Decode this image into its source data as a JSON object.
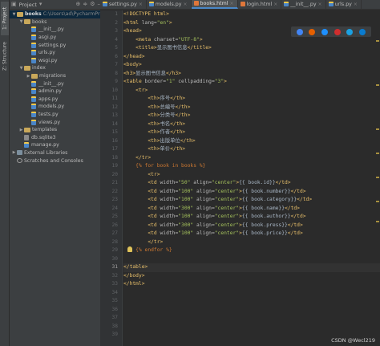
{
  "sidebar_tabs": {
    "project": "1: Project",
    "structure": "Z: Structure"
  },
  "project_panel": {
    "title": "Project",
    "tree": [
      {
        "name": "books",
        "extra": "C:\\Users\\ad\\PycharmPro",
        "type": "folder",
        "depth": 0,
        "expanded": true,
        "selected": true,
        "bold": true
      },
      {
        "name": "books",
        "type": "folder",
        "depth": 1,
        "expanded": true
      },
      {
        "name": "__init__.py",
        "type": "py",
        "depth": 2
      },
      {
        "name": "asgi.py",
        "type": "py",
        "depth": 2
      },
      {
        "name": "settings.py",
        "type": "py",
        "depth": 2
      },
      {
        "name": "urls.py",
        "type": "py",
        "depth": 2
      },
      {
        "name": "wsgi.py",
        "type": "py",
        "depth": 2
      },
      {
        "name": "index",
        "type": "folder",
        "depth": 1,
        "expanded": true
      },
      {
        "name": "migrations",
        "type": "folder",
        "depth": 2,
        "expanded": false
      },
      {
        "name": "__init__.py",
        "type": "py",
        "depth": 2
      },
      {
        "name": "admin.py",
        "type": "py",
        "depth": 2
      },
      {
        "name": "apps.py",
        "type": "py",
        "depth": 2
      },
      {
        "name": "models.py",
        "type": "py",
        "depth": 2
      },
      {
        "name": "tests.py",
        "type": "py",
        "depth": 2
      },
      {
        "name": "views.py",
        "type": "py",
        "depth": 2
      },
      {
        "name": "templates",
        "type": "folder",
        "depth": 1,
        "expanded": false
      },
      {
        "name": "db.sqlite3",
        "type": "db",
        "depth": 1
      },
      {
        "name": "manage.py",
        "type": "py",
        "depth": 1
      },
      {
        "name": "External Libraries",
        "type": "lib",
        "depth": 0,
        "expanded": false
      },
      {
        "name": "Scratches and Consoles",
        "type": "scratch",
        "depth": 0
      }
    ]
  },
  "tabs": [
    {
      "label": "settings.py",
      "type": "py",
      "active": false
    },
    {
      "label": "models.py",
      "type": "py",
      "active": false
    },
    {
      "label": "books.html",
      "type": "html",
      "active": true
    },
    {
      "label": "login.html",
      "type": "html",
      "active": false
    },
    {
      "label": "__init__.py",
      "type": "py",
      "active": false
    },
    {
      "label": "urls.py",
      "type": "py",
      "active": false
    }
  ],
  "colors": {
    "tag": "#e8bf6a",
    "attr": "#bababa",
    "value": "#a5c25c",
    "text": "#a9b7c6",
    "template": "#cc7832",
    "accent": "#4a88c7"
  },
  "browser_icons": [
    "chrome-icon",
    "firefox-icon",
    "safari-icon",
    "opera-icon",
    "ie-icon",
    "edge-icon"
  ],
  "browser_icon_colors": [
    "#4285f4",
    "#e66000",
    "#1e90ff",
    "#d02e2e",
    "#1ba1e2",
    "#0a7cd0"
  ],
  "code_lines": [
    [
      [
        "tag",
        "<!DOCTYPE html>"
      ]
    ],
    [
      [
        "tag",
        "<html "
      ],
      [
        "attr",
        "lang="
      ],
      [
        "value",
        "\"en\""
      ],
      [
        "tag",
        ">"
      ]
    ],
    [
      [
        "tag",
        "<head>"
      ]
    ],
    [
      [
        "text",
        "    "
      ],
      [
        "tag",
        "<meta "
      ],
      [
        "attr",
        "charset="
      ],
      [
        "value",
        "\"UTF-8\""
      ],
      [
        "tag",
        ">"
      ]
    ],
    [
      [
        "text",
        "    "
      ],
      [
        "tag",
        "<title>"
      ],
      [
        "text",
        "显示图书信息"
      ],
      [
        "tag",
        "</title>"
      ]
    ],
    [
      [
        "tag",
        "</head>"
      ]
    ],
    [
      [
        "tag",
        "<body>"
      ]
    ],
    [
      [
        "tag",
        "<h3>"
      ],
      [
        "text",
        "显示图书信息"
      ],
      [
        "tag",
        "</h3>"
      ]
    ],
    [
      [
        "tag",
        "<table "
      ],
      [
        "attr",
        "border="
      ],
      [
        "value",
        "\"1\" "
      ],
      [
        "attr",
        "cellpadding="
      ],
      [
        "value",
        "\"3\""
      ],
      [
        "tag",
        ">"
      ]
    ],
    [
      [
        "text",
        "    "
      ],
      [
        "tag",
        "<tr>"
      ]
    ],
    [
      [
        "text",
        "        "
      ],
      [
        "tag",
        "<th>"
      ],
      [
        "text",
        "序号"
      ],
      [
        "tag",
        "</th>"
      ]
    ],
    [
      [
        "text",
        "        "
      ],
      [
        "tag",
        "<th>"
      ],
      [
        "text",
        "总编号"
      ],
      [
        "tag",
        "</th>"
      ]
    ],
    [
      [
        "text",
        "        "
      ],
      [
        "tag",
        "<th>"
      ],
      [
        "text",
        "分类号"
      ],
      [
        "tag",
        "</th>"
      ]
    ],
    [
      [
        "text",
        "        "
      ],
      [
        "tag",
        "<th>"
      ],
      [
        "text",
        "书名"
      ],
      [
        "tag",
        "</th>"
      ]
    ],
    [
      [
        "text",
        "        "
      ],
      [
        "tag",
        "<th>"
      ],
      [
        "text",
        "作者"
      ],
      [
        "tag",
        "</th>"
      ]
    ],
    [
      [
        "text",
        "        "
      ],
      [
        "tag",
        "<th>"
      ],
      [
        "text",
        "出版单位"
      ],
      [
        "tag",
        "</th>"
      ]
    ],
    [
      [
        "text",
        "        "
      ],
      [
        "tag",
        "<th>"
      ],
      [
        "text",
        "单价"
      ],
      [
        "tag",
        "</th>"
      ]
    ],
    [
      [
        "text",
        "    "
      ],
      [
        "tag",
        "</tr>"
      ]
    ],
    [
      [
        "text",
        "    "
      ],
      [
        "template",
        "{% for book in books %}"
      ]
    ],
    [
      [
        "text",
        "        "
      ],
      [
        "tag",
        "<tr>"
      ]
    ],
    [
      [
        "text",
        "        "
      ],
      [
        "tag",
        "<td "
      ],
      [
        "attr",
        "width="
      ],
      [
        "value",
        "\"50\" "
      ],
      [
        "attr",
        "align="
      ],
      [
        "value",
        "\"center\""
      ],
      [
        "tag",
        ">"
      ],
      [
        "text",
        "{{ book.id}}"
      ],
      [
        "tag",
        "</td>"
      ]
    ],
    [
      [
        "text",
        "        "
      ],
      [
        "tag",
        "<td "
      ],
      [
        "attr",
        "width="
      ],
      [
        "value",
        "\"100\" "
      ],
      [
        "attr",
        "align="
      ],
      [
        "value",
        "\"center\""
      ],
      [
        "tag",
        ">"
      ],
      [
        "text",
        "{{ book.number}}"
      ],
      [
        "tag",
        "</td>"
      ]
    ],
    [
      [
        "text",
        "        "
      ],
      [
        "tag",
        "<td "
      ],
      [
        "attr",
        "width="
      ],
      [
        "value",
        "\"100\" "
      ],
      [
        "attr",
        "align="
      ],
      [
        "value",
        "\"center\""
      ],
      [
        "tag",
        ">"
      ],
      [
        "text",
        "{{ book.category}}"
      ],
      [
        "tag",
        "</td>"
      ]
    ],
    [
      [
        "text",
        "        "
      ],
      [
        "tag",
        "<td "
      ],
      [
        "attr",
        "width="
      ],
      [
        "value",
        "\"300\" "
      ],
      [
        "attr",
        "align="
      ],
      [
        "value",
        "\"center\""
      ],
      [
        "tag",
        ">"
      ],
      [
        "text",
        "{{ book.name}}"
      ],
      [
        "tag",
        "</td>"
      ]
    ],
    [
      [
        "text",
        "        "
      ],
      [
        "tag",
        "<td "
      ],
      [
        "attr",
        "width="
      ],
      [
        "value",
        "\"100\" "
      ],
      [
        "attr",
        "align="
      ],
      [
        "value",
        "\"center\""
      ],
      [
        "tag",
        ">"
      ],
      [
        "text",
        "{{ book.author}}"
      ],
      [
        "tag",
        "</td>"
      ]
    ],
    [
      [
        "text",
        "        "
      ],
      [
        "tag",
        "<td "
      ],
      [
        "attr",
        "width="
      ],
      [
        "value",
        "\"300\" "
      ],
      [
        "attr",
        "align="
      ],
      [
        "value",
        "\"center\""
      ],
      [
        "tag",
        ">"
      ],
      [
        "text",
        "{{ book.press}}"
      ],
      [
        "tag",
        "</td>"
      ]
    ],
    [
      [
        "text",
        "        "
      ],
      [
        "tag",
        "<td "
      ],
      [
        "attr",
        "width="
      ],
      [
        "value",
        "\"100\" "
      ],
      [
        "attr",
        "align="
      ],
      [
        "value",
        "\"center\""
      ],
      [
        "tag",
        ">"
      ],
      [
        "text",
        "{{ book.price}}"
      ],
      [
        "tag",
        "</td>"
      ]
    ],
    [
      [
        "text",
        "        "
      ],
      [
        "tag",
        "</tr>"
      ]
    ],
    [
      [
        "text",
        "    "
      ],
      [
        "template",
        "{% endfor %}"
      ]
    ],
    [],
    [
      [
        "tag",
        "</table>"
      ]
    ],
    [
      [
        "tag",
        "</body>"
      ]
    ],
    [
      [
        "tag",
        "</html>"
      ]
    ],
    [],
    [],
    [],
    [],
    [],
    []
  ],
  "line_numbers": [
    "1",
    "2",
    "3",
    "4",
    "5",
    "6",
    "7",
    "8",
    "9",
    "10",
    "11",
    "12",
    "13",
    "14",
    "15",
    "16",
    "17",
    "18",
    "19",
    "20",
    "21",
    "22",
    "23",
    "24",
    "25",
    "26",
    "27",
    "28",
    "29",
    "30",
    "31",
    "32",
    "33",
    "34",
    "35",
    "36",
    "37",
    "38",
    "39"
  ],
  "current_line": 31,
  "watermark": "CSDN @Wecl219"
}
